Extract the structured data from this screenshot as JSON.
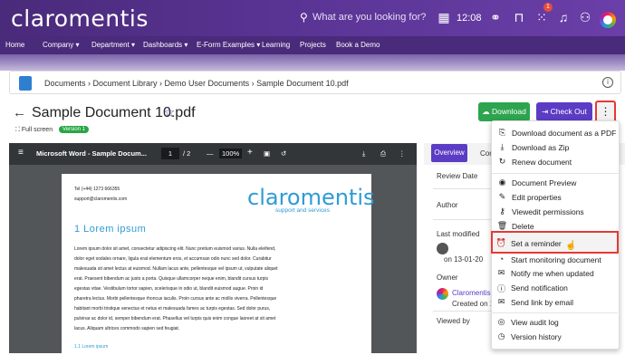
{
  "topbar": {
    "logo": "claromentis",
    "search_placeholder": "What are you looking for?",
    "time": "12:08",
    "notification_count": "1"
  },
  "nav": [
    "Home",
    "Company ▾",
    "Department ▾",
    "Dashboards ▾",
    "E-Form Examples ▾",
    "Learning",
    "Projects",
    "Book a Demo"
  ],
  "breadcrumb": "Documents › Document Library › Demo User Documents › Sample Document 10.pdf",
  "document": {
    "title": "Sample Document 10.pdf",
    "full_screen": "Full screen",
    "version": "Version 1"
  },
  "buttons": {
    "download": "Download",
    "check_out": "Check Out",
    "more": "⋮"
  },
  "viewer": {
    "filename": "Microsoft Word - Sample Docum...",
    "page_current": "1",
    "page_total": "/ 2",
    "zoom": "100%"
  },
  "page": {
    "tel": "Tel (+44) 1273 666355",
    "email": "support@claromentis.com",
    "logo": "claromentis",
    "logo_sub": "support and services",
    "heading": "1   Lorem ipsum",
    "lines": [
      "Lorem ipsum dolor sit amet, consectetur adipiscing elit. Nunc pretium euismod varius. Nulla eleifend,",
      "dolor eget sodales ornare, ligula erat elementum eros, et accumsan odio nunc sed dolor. Curabitur",
      "malesuada sit amet lectus at euismod. Nullam lacus ante, pellentesque vel ipsum ut, vulputate aliquet",
      "erat. Praesent bibendum ac justo a porta. Quisque ullamcorper neque enim, blandit cursus turpis",
      "egestas vitae. Vestibulum tortor sapien, scelerisque in odio ut, blandit euismod augue. Proin id",
      "pharetra lectus. Morbi pellentesque rhoncus iaculis. Proin cursus ante ac mollis viverra. Pellentesque",
      "habitant morbi tristique senectus et netus et malesuada fames ac turpis egestas. Sed dolor purus,",
      "pulvinar ac dolor id, semper bibendum erat. Phasellus vel turpis quis enim congue laoreet at sit amet",
      "lacus. Aliquam ultrices commodo sapien sed feugiat."
    ],
    "subheading": "1.1   Lorem ipsum"
  },
  "sidepanel": {
    "tab_overview": "Overview",
    "tab_comments": "Cor",
    "review_date": "Review Date",
    "author": "Author",
    "last_modified": "Last modified",
    "modified_on": "on 13-01-20",
    "owner": "Owner",
    "owner_name": "Claromentis A",
    "owner_created": "Created on 1:",
    "viewed_by": "Viewed by"
  },
  "menu": [
    {
      "icon": "⎘",
      "label": "Download document as a PDF"
    },
    {
      "icon": "⤓",
      "label": "Download as Zip"
    },
    {
      "icon": "↻",
      "label": "Renew document"
    },
    {
      "icon": "◉",
      "label": "Document Preview"
    },
    {
      "icon": "✎",
      "label": "Edit properties"
    },
    {
      "icon": "⚷",
      "label": "Viewedit permissions"
    },
    {
      "icon": "🗑",
      "label": "Delete"
    },
    {
      "icon": "⏰",
      "label": "Set a reminder"
    },
    {
      "icon": "◔",
      "label": "Start monitoring document"
    },
    {
      "icon": "✉",
      "label": "Notify me when updated"
    },
    {
      "icon": "ⓘ",
      "label": "Send notification"
    },
    {
      "icon": "✉",
      "label": "Send link by email"
    },
    {
      "icon": "◎",
      "label": "View audit log"
    },
    {
      "icon": "◷",
      "label": "Version history"
    }
  ],
  "colors": {
    "brand": "#5b3596",
    "download": "#2ea44f",
    "checkout": "#5b3cc4",
    "highlight": "#e53935"
  }
}
